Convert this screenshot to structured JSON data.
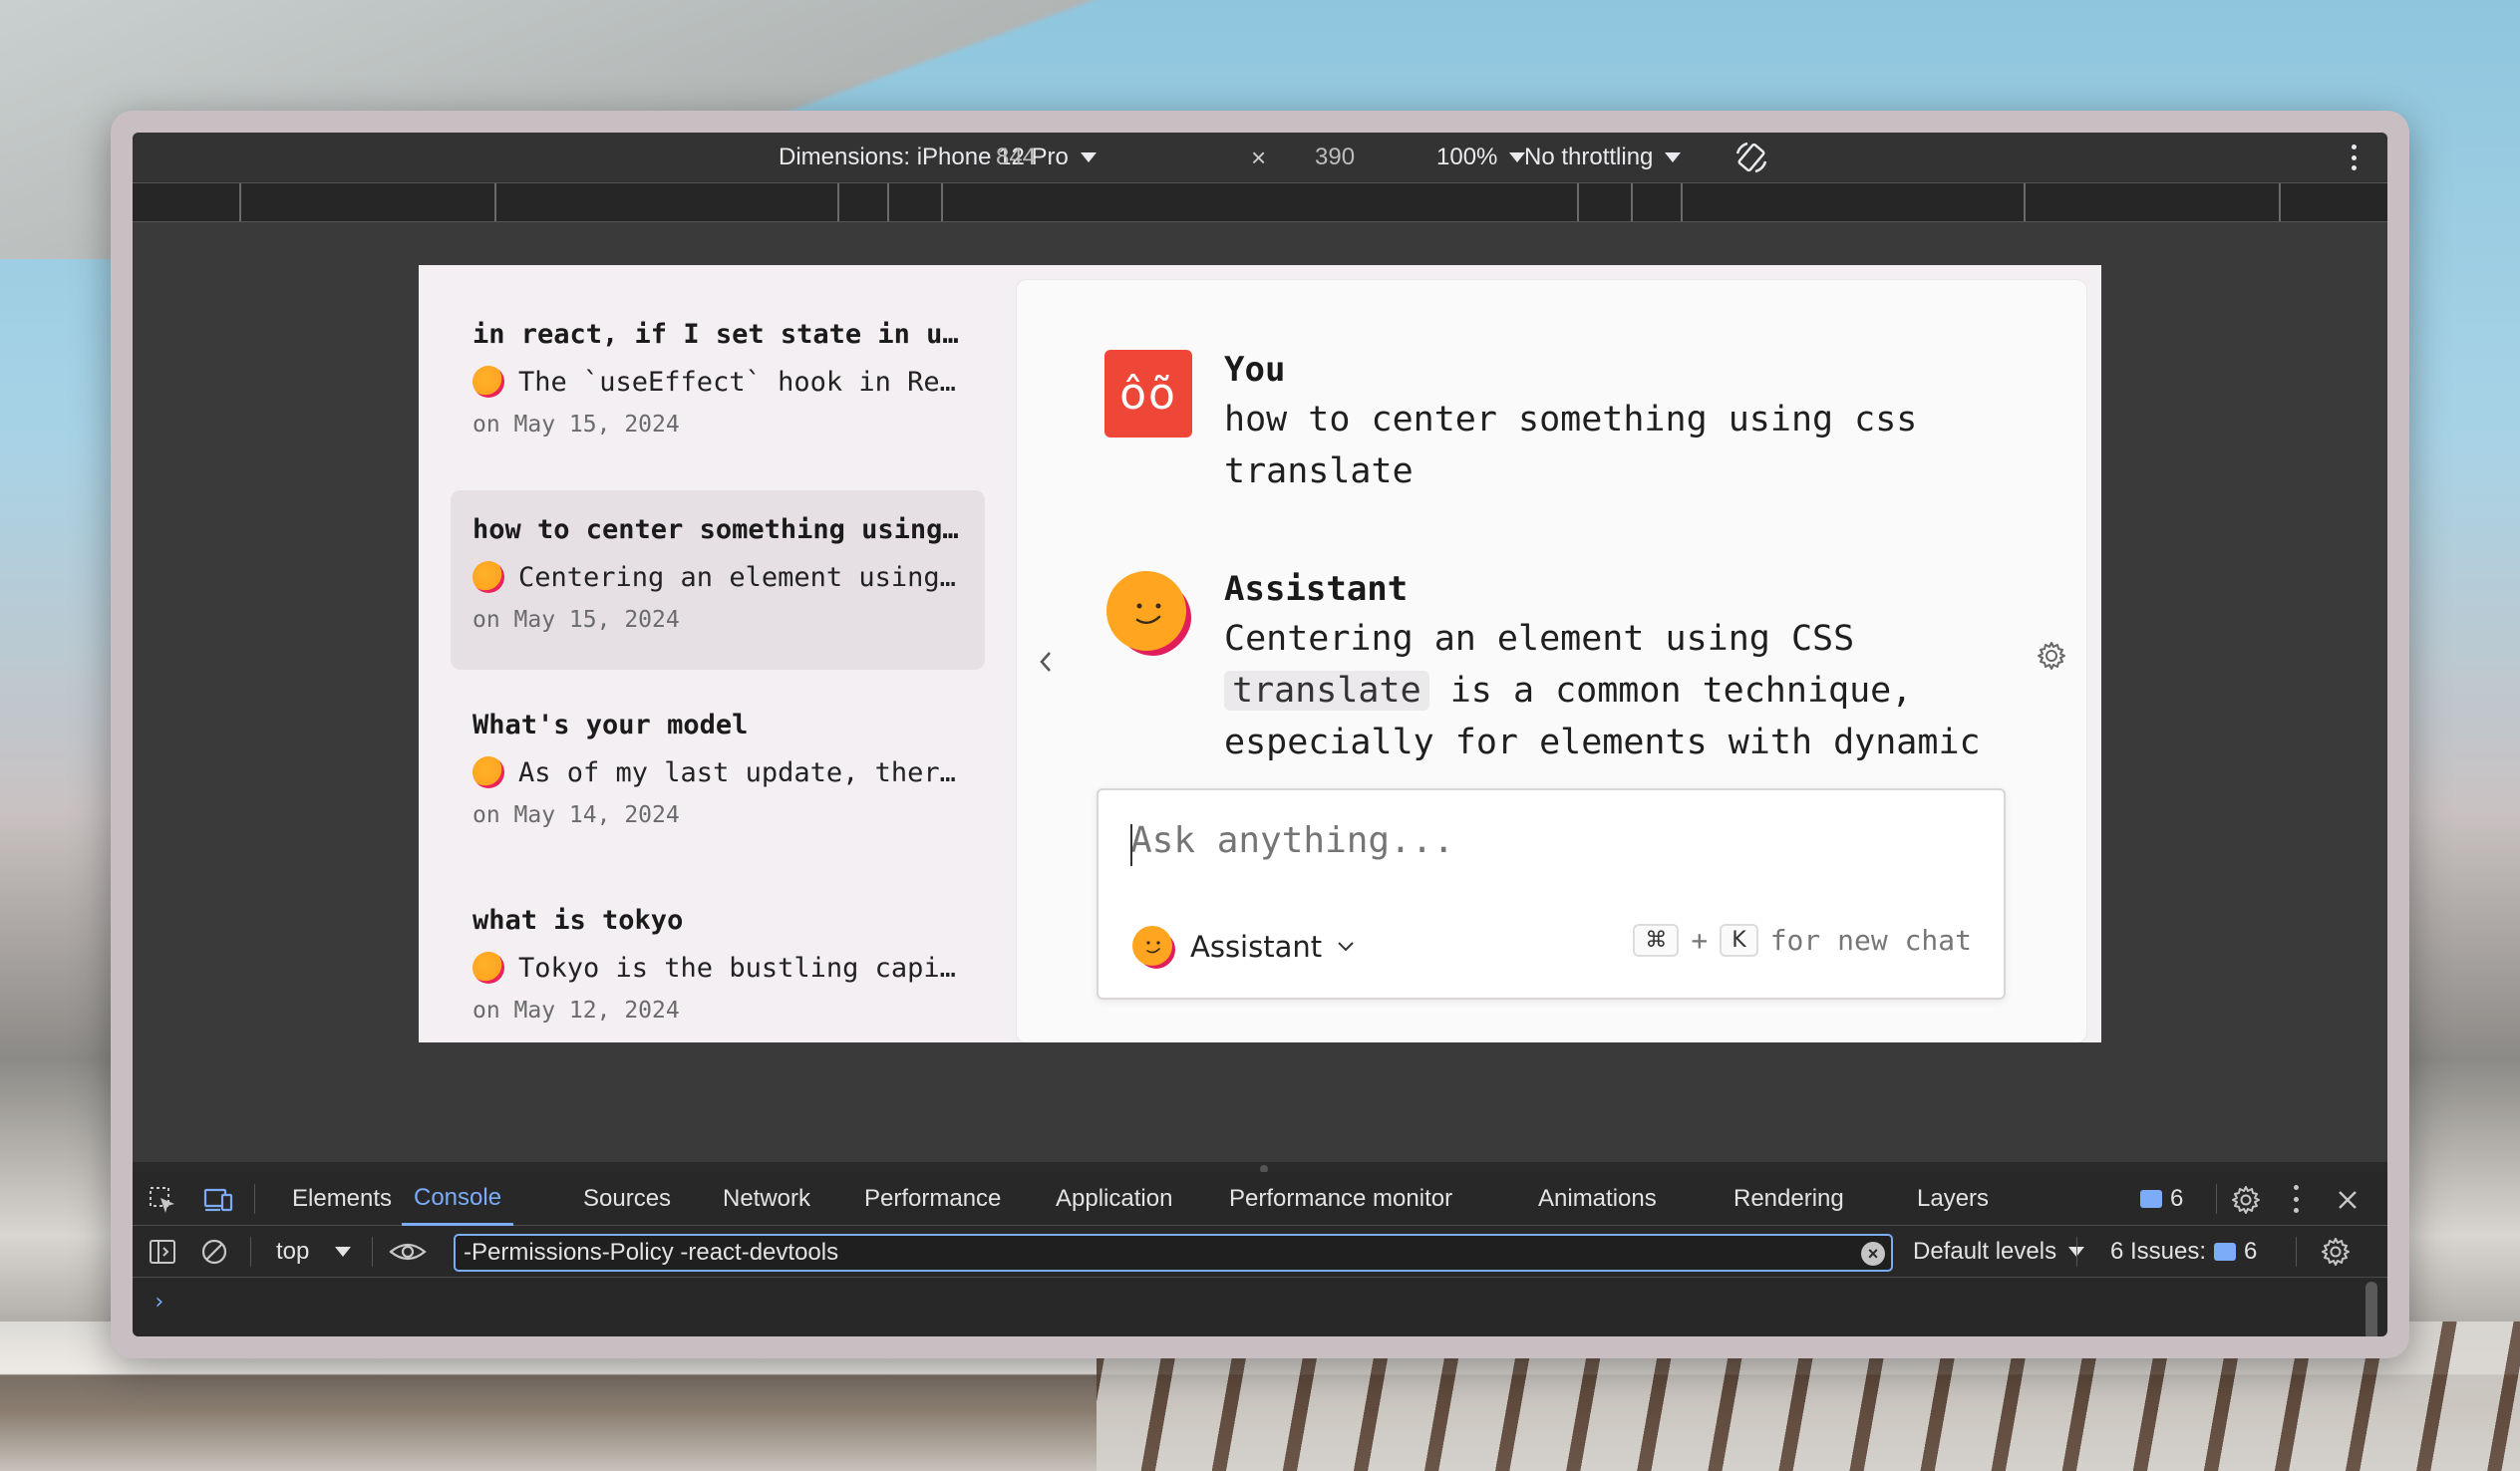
{
  "device_toolbar": {
    "dimensions_label": "Dimensions: iPhone 12 Pro",
    "width": "844",
    "times": "×",
    "height": "390",
    "zoom": "100%",
    "throttling": "No throttling"
  },
  "sidebar": {
    "items": [
      {
        "title": "in react, if I set state in use e...",
        "preview": "The `useEffect` hook in Re...",
        "date": "on May 15, 2024",
        "active": false
      },
      {
        "title": "how to center something using...",
        "preview": "Centering an element using ...",
        "date": "on May 15, 2024",
        "active": true
      },
      {
        "title": "What's your model",
        "preview": "As of my last update, there...",
        "date": "on May 14, 2024",
        "active": false
      },
      {
        "title": "what is tokyo",
        "preview": "Tokyo is the bustling capita...",
        "date": "on May 12, 2024",
        "active": false
      }
    ]
  },
  "conversation": {
    "user": {
      "avatar_text": "ôõ",
      "name": "You",
      "text": "how to center something using css translate"
    },
    "assistant": {
      "name": "Assistant",
      "text_before": "Centering an element using CSS",
      "code": "translate",
      "text_after": "is a common technique, especially for elements with dynamic"
    }
  },
  "composer": {
    "placeholder": "Ask anything...",
    "model_label": "Assistant",
    "shortcut_cmd": "⌘",
    "shortcut_plus": "+",
    "shortcut_key": "K",
    "shortcut_hint": "for new chat"
  },
  "devtools": {
    "tabs": [
      "Elements",
      "Console",
      "Sources",
      "Network",
      "Performance",
      "Application",
      "Performance monitor",
      "Animations",
      "Rendering",
      "Layers"
    ],
    "active_tab": "Console",
    "message_count": "6",
    "context": "top",
    "filter_value": "-Permissions-Policy -react-devtools",
    "levels": "Default levels",
    "issues_label": "6 Issues:",
    "issues_count": "6",
    "prompt": "›"
  },
  "colors": {
    "accent": "#7cacf8",
    "you_avatar": "#ee4738",
    "assistant_face": "#ffa51f",
    "assistant_shadow": "#e11d5c"
  }
}
